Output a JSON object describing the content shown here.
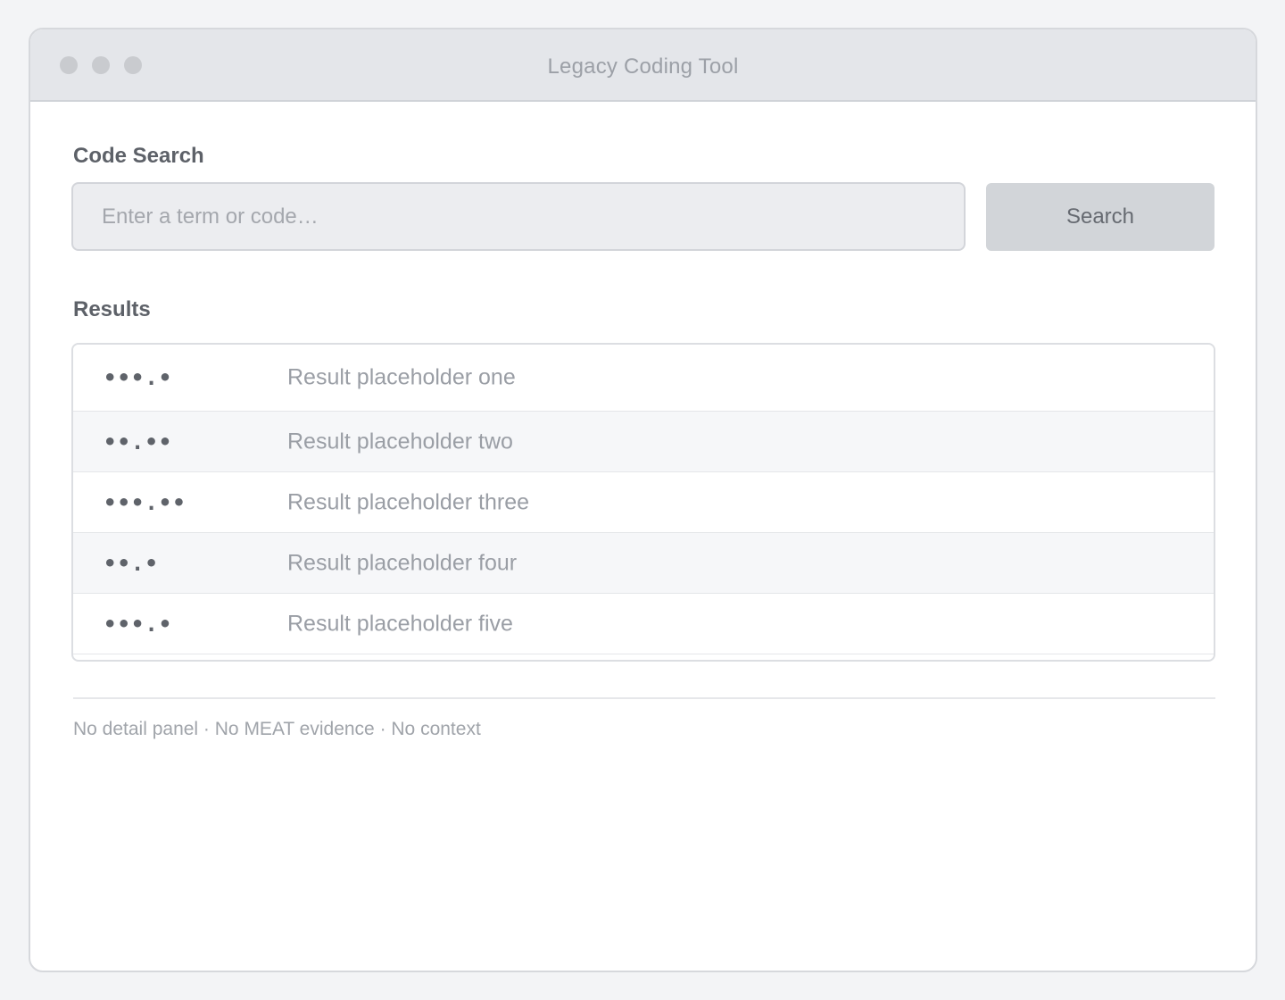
{
  "window": {
    "title": "Legacy Coding Tool"
  },
  "search": {
    "section_label": "Code Search",
    "placeholder": "Enter a term or code…",
    "button_label": "Search"
  },
  "results": {
    "section_label": "Results",
    "rows": [
      {
        "code": "•••.•",
        "label": "Result placeholder one"
      },
      {
        "code": "••.••",
        "label": "Result placeholder two"
      },
      {
        "code": "•••.••",
        "label": "Result placeholder three"
      },
      {
        "code": "••.•",
        "label": "Result placeholder four"
      },
      {
        "code": "•••.•",
        "label": "Result placeholder five"
      }
    ]
  },
  "footer": {
    "note": "No detail panel · No MEAT evidence · No context"
  },
  "colors": {
    "page_background": "#f3f4f6",
    "titlebar": "#e4e6ea",
    "button": "#d2d5d9",
    "input": "#ecedf0",
    "alt_row": "#f6f7f9"
  }
}
